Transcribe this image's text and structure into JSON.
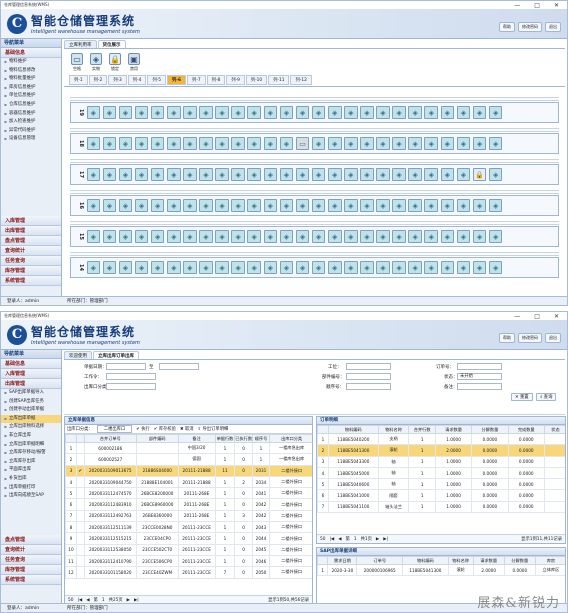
{
  "window": {
    "title": "仓库管理信息系统(WMS)",
    "controls": [
      "—",
      "□",
      "✕"
    ]
  },
  "brand": {
    "cn": "智能仓储管理系统",
    "en": "Intelligent warehouse management system",
    "logo": "C"
  },
  "top_buttons": [
    "帮助",
    "修改密码",
    "退出"
  ],
  "screen1": {
    "nav_head": "导航菜单",
    "nav_open_section": "基础信息",
    "nav_items": [
      "物料维护",
      "物料信息修改",
      "物料批量维护",
      "库房信息维护",
      "单位信息维护",
      "仓库信息维护",
      "容器信息维护",
      "加入检查维护",
      "异常代码维护",
      "设备信息管理"
    ],
    "nav_sections": [
      "入库管理",
      "出库管理",
      "盘点管理",
      "查询统计",
      "任务查询",
      "库存管理",
      "系统管理"
    ],
    "tabs": [
      "立库利用率",
      "货位展示"
    ],
    "legend": [
      "空格",
      "实物",
      "锁定",
      "禁用"
    ],
    "row_tabs": [
      "列-1",
      "列-2",
      "列-3",
      "列-4",
      "列-5",
      "列-6",
      "列-7",
      "列-8",
      "列-9",
      "列-10",
      "列-11",
      "列-12"
    ],
    "active_row_tab": "列-6",
    "shelves": [
      {
        "level": "19",
        "empty": []
      },
      {
        "level": "18",
        "empty": [
          13
        ]
      },
      {
        "level": "17",
        "empty": [],
        "lock": [
          24
        ]
      },
      {
        "level": "16",
        "empty": []
      },
      {
        "level": "15",
        "empty": []
      },
      {
        "level": "14",
        "empty": []
      }
    ],
    "status": [
      "登录人：admin",
      "所在部门：管理部门"
    ]
  },
  "screen2": {
    "nav_head": "导航菜单",
    "nav_top_sections": [
      "基础信息",
      "入库管理",
      "出库管理"
    ],
    "nav_items": [
      "SAP出库单据导入",
      "创建SAP出库任务",
      "创建手动出库单据",
      "立库出库单据",
      "立库出库物料选择",
      "非立库出库",
      "立库出库单据明细",
      "立库库存移动/报警",
      "立库库存出库",
      "平面库出库",
      "补货出库",
      "出库单据打印",
      "出库向成绩至SAP"
    ],
    "selected_nav": "立库出库单据",
    "nav_bottom_sections": [
      "盘点管理",
      "查询统计",
      "任务查询",
      "库存管理",
      "系统管理"
    ],
    "tabs": [
      "欢迎使用",
      "立库出库订单出库"
    ],
    "form": {
      "labels": [
        "单据日期：",
        "工作令：",
        "出库口分类：",
        "工位：",
        "部件编号：",
        "顺序号：",
        "订单号：",
        "状态：",
        "备注："
      ],
      "date_sep": "至",
      "status_value": "未开始",
      "buttons": [
        "重置",
        "查询"
      ]
    },
    "left_panel": {
      "title": "立库单据信息",
      "toolbar": [
        "出库口分类：",
        "二楼出库口",
        "执行",
        "库存校验",
        "取消",
        "导出订单明细"
      ],
      "columns": [
        "",
        "",
        "合并订单号",
        "部件编码",
        "备注",
        "单据行数",
        "已执行数",
        "顺序号",
        "出库口分类"
      ],
      "rows": [
        [
          "1",
          "",
          "600002186",
          "",
          "中国3/20",
          "1",
          "0",
          "1",
          "一楼库急出库"
        ],
        [
          "2",
          "",
          "600002527",
          "",
          "德国",
          "1",
          "0",
          "1",
          "一楼库急出库"
        ],
        [
          "3",
          "✔",
          "2020033109013675",
          "21886S04000",
          "20111-21888",
          "11",
          "0",
          "2031",
          "二楼外接口"
        ],
        [
          "4",
          "",
          "2020033109044750",
          "21888E104001",
          "20111-21888",
          "1",
          "2",
          "2034",
          "二楼外接口"
        ],
        [
          "5",
          "",
          "2020033112474570",
          "26BCE8200000",
          "20111-268E",
          "1",
          "0",
          "2041",
          "二楼外接口"
        ],
        [
          "6",
          "",
          "2020033112483910",
          "26BCE8960000",
          "20111-268E",
          "1",
          "0",
          "2042",
          "二楼外接口"
        ],
        [
          "7",
          "",
          "2020033112492763",
          "26BE8360000",
          "20111-268E",
          "1",
          "3",
          "2042",
          "二楼外接口"
        ],
        [
          "8",
          "",
          "2020033112511139",
          "23CCE0028N0",
          "20111-23CCE",
          "1",
          "0",
          "2043",
          "二楼外接口"
        ],
        [
          "9",
          "",
          "2020033112515215",
          "23CCE04CP0",
          "20111-23CCE",
          "1",
          "0",
          "2044",
          "二楼外接口"
        ],
        [
          "10",
          "",
          "2020033112538050",
          "23CCE502CT0",
          "20111-23CCE",
          "1",
          "0",
          "2045",
          "二楼外接口"
        ],
        [
          "11",
          "",
          "2020033112410790",
          "23CCE506CP0",
          "20111-23CCE",
          "1",
          "0",
          "2046",
          "二楼外接口"
        ],
        [
          "12",
          "",
          "2020033101158020",
          "23CCE40ZWM",
          "20111-23CCE",
          "7",
          "0",
          "2050",
          "二楼外接口"
        ]
      ],
      "selected_row": 2,
      "pager": [
        "50",
        "第",
        "1",
        "共25页",
        "显示1到50,共56记录"
      ]
    },
    "right_panel": {
      "title": "订单明细",
      "columns": [
        "",
        "物料编码",
        "物料名称",
        "合并行数",
        "请求数量",
        "分解数量",
        "完成数量",
        "状态"
      ],
      "rows": [
        [
          "1",
          "118BE5040200",
          "支柄",
          "1",
          "1.0000",
          "0.0000",
          "0.0000",
          ""
        ],
        [
          "2",
          "118BE5041300",
          "滚轮",
          "1",
          "2.0000",
          "0.0000",
          "0.0000",
          ""
        ],
        [
          "3",
          "118BE5043300",
          "轴",
          "1",
          "1.0000",
          "0.0000",
          "0.0000",
          ""
        ],
        [
          "4",
          "118BE5045000",
          "轴",
          "1",
          "1.0000",
          "0.0000",
          "0.0000",
          ""
        ],
        [
          "5",
          "118BE5040600",
          "轴",
          "1",
          "1.0000",
          "0.0000",
          "0.0000",
          ""
        ],
        [
          "6",
          "118BE5041000",
          "隔套",
          "1",
          "1.0000",
          "0.0000",
          "0.0000",
          ""
        ],
        [
          "7",
          "118BE5041100",
          "轴头法兰",
          "1",
          "1.0000",
          "0.0000",
          "0.0000",
          ""
        ]
      ],
      "selected_row": 1,
      "pager": [
        "50",
        "第",
        "1",
        "共1页",
        "显示1到11,共11记录"
      ]
    },
    "sap_panel": {
      "title": "SAP出库单据详细",
      "columns": [
        "",
        "需求日期",
        "订单号",
        "物料编码",
        "物料名称",
        "请求数量",
        "分解数量",
        "库房"
      ],
      "rows": [
        [
          "1",
          "2020-3-30",
          "200000106965",
          "118BE5041300",
          "滚轮",
          "2.0000",
          "0.0000",
          "立体库区"
        ]
      ]
    },
    "status": [
      "登录人：admin",
      "所在部门：管理部门"
    ]
  },
  "watermark": "展森&新锐力"
}
